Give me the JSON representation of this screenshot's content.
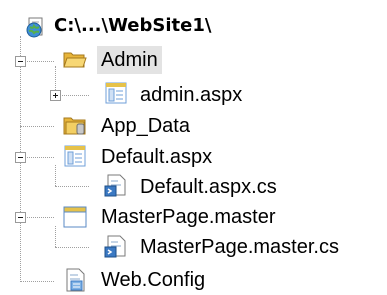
{
  "tree": {
    "root": {
      "label": "C:\\...\\WebSite1\\",
      "icon": "globe-project-icon"
    },
    "nodes": [
      {
        "label": "Admin",
        "icon": "open-folder-icon",
        "toggle": "minus",
        "selected": true
      },
      {
        "label": "admin.aspx",
        "icon": "aspx-page-icon",
        "toggle": "plus"
      },
      {
        "label": "App_Data",
        "icon": "data-folder-icon"
      },
      {
        "label": "Default.aspx",
        "icon": "aspx-page-icon",
        "toggle": "minus"
      },
      {
        "label": "Default.aspx.cs",
        "icon": "cs-code-file-icon"
      },
      {
        "label": "MasterPage.master",
        "icon": "master-page-icon",
        "toggle": "minus"
      },
      {
        "label": "MasterPage.master.cs",
        "icon": "cs-code-file-icon"
      },
      {
        "label": "Web.Config",
        "icon": "config-file-icon"
      }
    ]
  },
  "colors": {
    "selection": "#e3e3e3",
    "folder": "#f4c542",
    "page": "#6f9fd8",
    "tree_lines": "#a0a0a0"
  }
}
